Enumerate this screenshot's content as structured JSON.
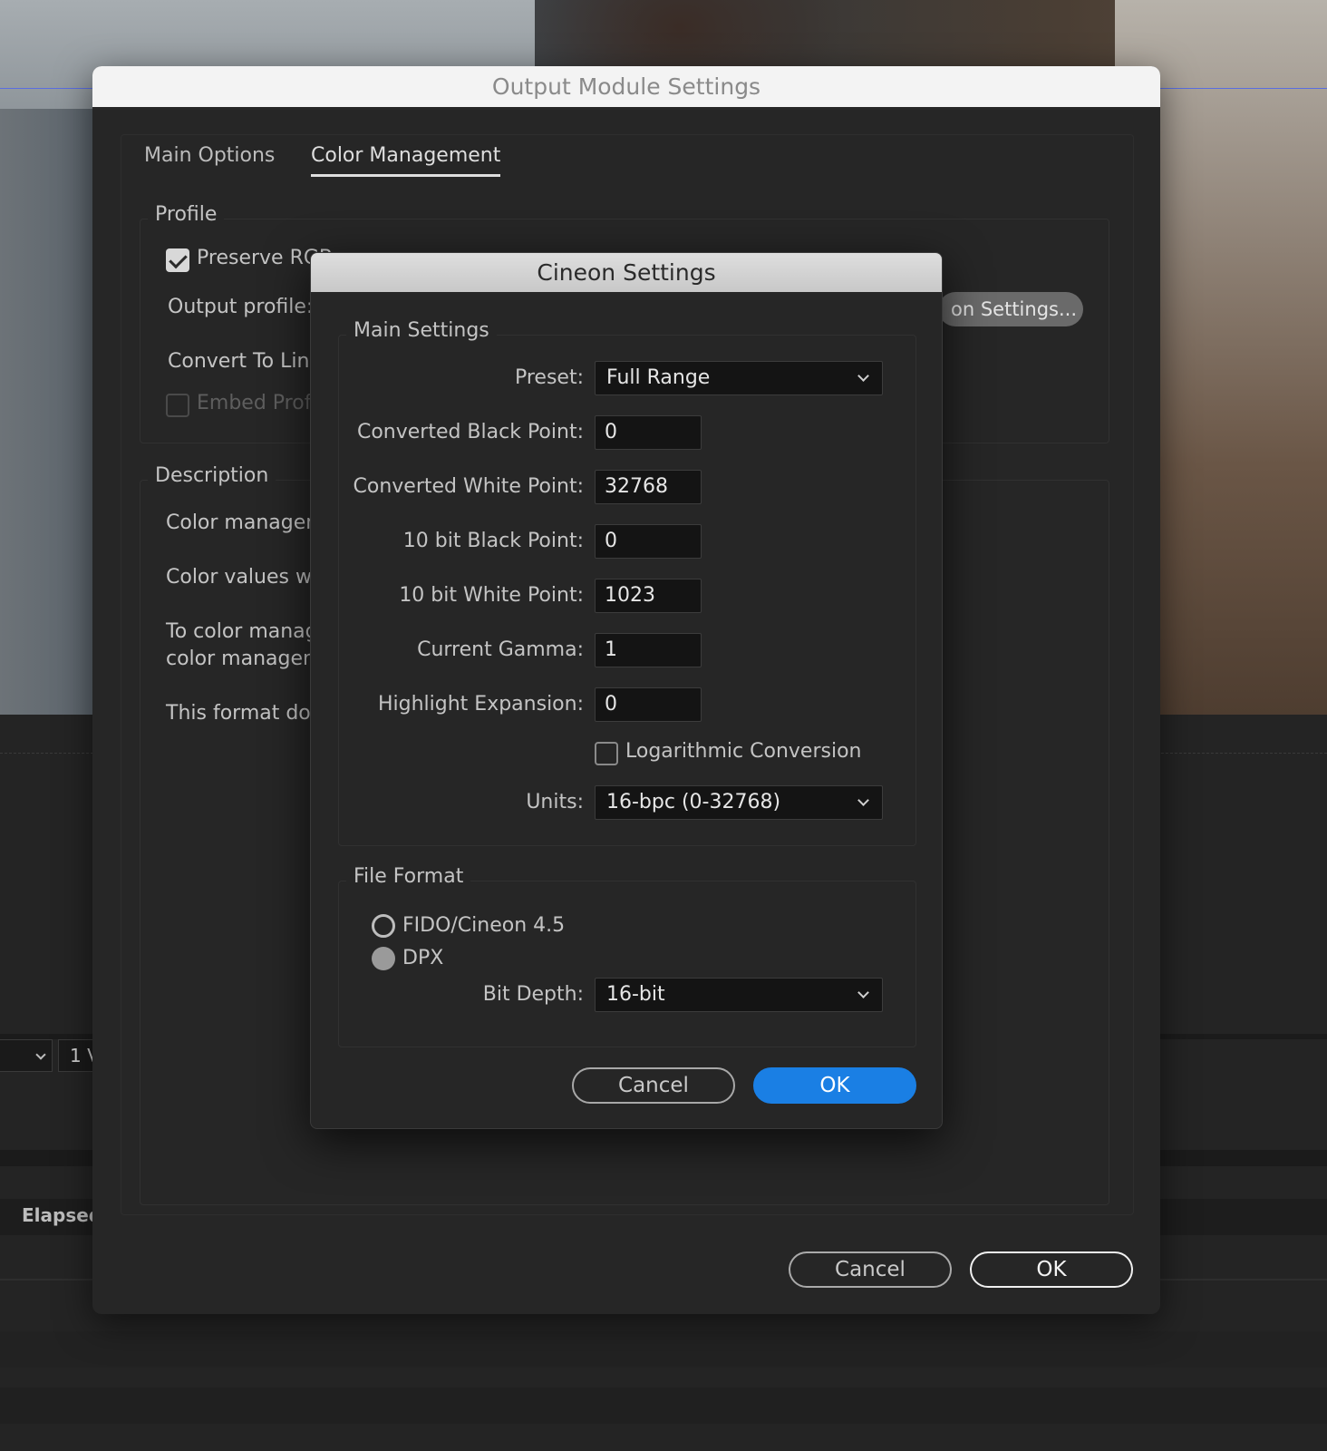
{
  "background": {
    "dropdown_value": "",
    "field_value": "1 V",
    "elapsed_label": "Elapsed:"
  },
  "output_module": {
    "title": "Output Module Settings",
    "tabs": [
      {
        "label": "Main Options",
        "active": false
      },
      {
        "label": "Color Management",
        "active": true
      }
    ],
    "profile": {
      "legend": "Profile",
      "preserve_rgb_label": "Preserve RGB",
      "preserve_rgb_checked": true,
      "output_profile_label": "Output profile:",
      "settings_button_label": "on Settings...",
      "convert_to_linear_label": "Convert To Linear",
      "embed_profile_label": "Embed Profile",
      "embed_profile_checked": false
    },
    "description": {
      "legend": "Description",
      "lines": [
        "Color management",
        "Color values will",
        "To color manage",
        "color management",
        "This format does"
      ]
    },
    "cancel_label": "Cancel",
    "ok_label": "OK"
  },
  "cineon": {
    "title": "Cineon Settings",
    "main_settings": {
      "legend": "Main Settings",
      "preset_label": "Preset:",
      "preset_value": "Full Range",
      "converted_black_point_label": "Converted Black Point:",
      "converted_black_point_value": "0",
      "converted_white_point_label": "Converted White Point:",
      "converted_white_point_value": "32768",
      "bit10_black_point_label": "10 bit Black Point:",
      "bit10_black_point_value": "0",
      "bit10_white_point_label": "10 bit White Point:",
      "bit10_white_point_value": "1023",
      "current_gamma_label": "Current Gamma:",
      "current_gamma_value": "1",
      "highlight_expansion_label": "Highlight Expansion:",
      "highlight_expansion_value": "0",
      "log_conversion_label": "Logarithmic Conversion",
      "log_conversion_checked": false,
      "units_label": "Units:",
      "units_value": "16-bpc (0-32768)"
    },
    "file_format": {
      "legend": "File Format",
      "option_fido_label": "FIDO/Cineon 4.5",
      "option_dpx_label": "DPX",
      "selected": "DPX",
      "bit_depth_label": "Bit Depth:",
      "bit_depth_value": "16-bit"
    },
    "cancel_label": "Cancel",
    "ok_label": "OK",
    "accent_color": "#1a7fe4"
  }
}
